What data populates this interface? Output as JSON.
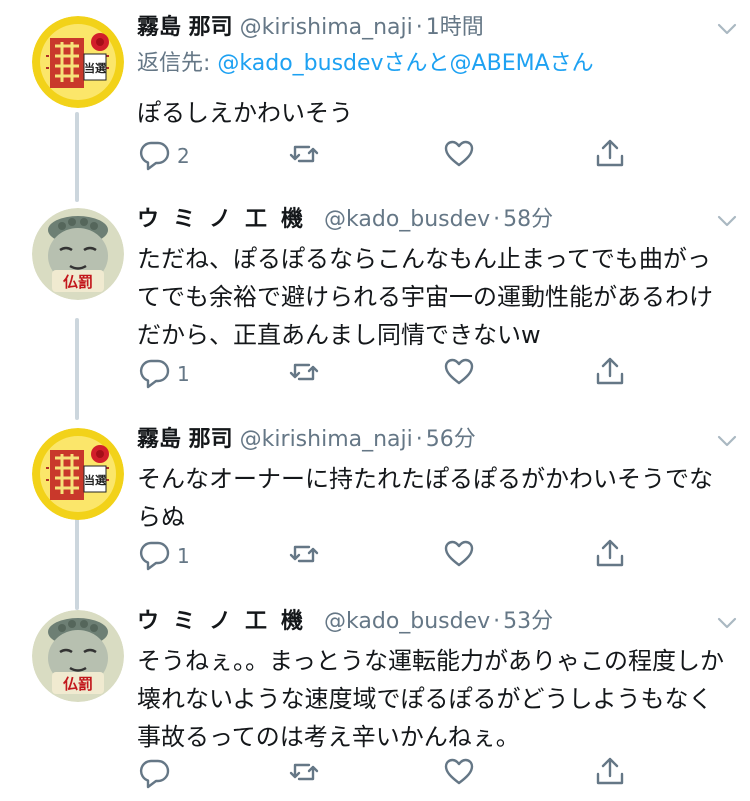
{
  "tweets": [
    {
      "name": "霧島 那司",
      "handle": "@kirishima_naji",
      "dot": "·",
      "time": "1時間",
      "reply_prefix": "返信先: ",
      "reply_links": "@kado_busdevさんと@ABEMAさん",
      "text": "ぽるしえかわいそう",
      "reply_count": "2",
      "retweet_count": "",
      "like_count": "",
      "avatar_text": "当選"
    },
    {
      "name": "ウミノ工機",
      "handle": "@kado_busdev",
      "dot": "·",
      "time": "58分",
      "text": "ただね、ぽるぽるならこんなもん止まってでも曲がってでも余裕で避けられる宇宙一の運動性能があるわけだから、正直あんまし同情できないw",
      "reply_count": "1",
      "retweet_count": "",
      "like_count": "",
      "avatar_text": "仏罰"
    },
    {
      "name": "霧島 那司",
      "handle": "@kirishima_naji",
      "dot": "·",
      "time": "56分",
      "text": "そんなオーナーに持たれたぽるぽるがかわいそうでならぬ",
      "reply_count": "1",
      "retweet_count": "",
      "like_count": "",
      "avatar_text": "当選"
    },
    {
      "name": "ウミノ工機",
      "handle": "@kado_busdev",
      "dot": "·",
      "time": "53分",
      "text": "そうねぇ。。まっとうな運転能力がありゃこの程度しか壊れないような速度域でぽるぽるがどうしようもなく事故るってのは考え辛いかんねぇ。",
      "reply_count": "",
      "retweet_count": "",
      "like_count": "",
      "avatar_text": "仏罰"
    }
  ],
  "icons": {
    "reply": "reply-icon",
    "retweet": "retweet-icon",
    "like": "heart-icon",
    "share": "share-icon",
    "more": "chevron-down-icon"
  },
  "colors": {
    "text": "#14171a",
    "secondary": "#657786",
    "link": "#1da1f2",
    "thread_line": "#ccd6dd"
  }
}
